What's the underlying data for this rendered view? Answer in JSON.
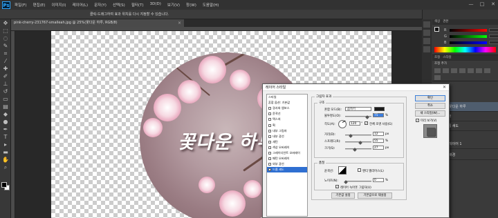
{
  "app": {
    "logo": "Ps",
    "menu": [
      "파일(F)",
      "편집(E)",
      "이미지(I)",
      "레이어(L)",
      "문자(Y)",
      "선택(S)",
      "필터(T)",
      "3D(D)",
      "보기(V)",
      "창(W)",
      "도움말(H)"
    ],
    "window_controls": [
      "—",
      "□",
      "✕"
    ]
  },
  "document": {
    "tab_title": "pink-cherry-231767-smalleah.jpg @ 25%(꽃다운 하루, RGB/8)",
    "tab_close": "×",
    "status_hint": "클릭-드래그하여 효과 위치를 다시 지정할 수 있습니다."
  },
  "canvas": {
    "text": "꽃다운 하루"
  },
  "color_panel": {
    "tabs": [
      "색상",
      "견본"
    ],
    "sliders": [
      {
        "label": "R",
        "color": "#d23c3c"
      },
      {
        "label": "G",
        "color": "#3cb43c"
      },
      {
        "label": "B",
        "color": "#3c5ad2"
      }
    ]
  },
  "adjust_panel": {
    "tabs": [
      "조정",
      "스타일"
    ],
    "title": "조정 추가"
  },
  "layers": [
    {
      "name": "꽃다운 하루",
      "type": "text",
      "selected": true
    },
    {
      "name": "효과",
      "type": "fx",
      "selected": false
    },
    {
      "name": "드롭 섀도",
      "type": "fx-item",
      "selected": false
    },
    {
      "name": "레이어 1",
      "type": "photo",
      "selected": false
    },
    {
      "name": "배경",
      "type": "bg",
      "selected": false
    }
  ],
  "dialog": {
    "title": "레이어 스타일",
    "close": "✕",
    "style_list": [
      {
        "label": "스타일",
        "checkbox": false,
        "selected": false
      },
      {
        "label": "혼합 옵션: 기본값",
        "checkbox": false,
        "selected": false
      },
      {
        "label": "경사와 엠보스",
        "checkbox": true,
        "selected": false
      },
      {
        "label": "윤곽선",
        "checkbox": true,
        "selected": false
      },
      {
        "label": "텍스처",
        "checkbox": true,
        "selected": false
      },
      {
        "label": "획",
        "checkbox": true,
        "selected": false
      },
      {
        "label": "내부 그림자",
        "checkbox": true,
        "selected": false
      },
      {
        "label": "내부 광선",
        "checkbox": true,
        "selected": false
      },
      {
        "label": "새틴",
        "checkbox": true,
        "selected": false
      },
      {
        "label": "색상 오버레이",
        "checkbox": true,
        "selected": false
      },
      {
        "label": "그레이디언트 오버레이",
        "checkbox": true,
        "selected": false
      },
      {
        "label": "패턴 오버레이",
        "checkbox": true,
        "selected": false
      },
      {
        "label": "외부 광선",
        "checkbox": true,
        "selected": false
      },
      {
        "label": "드롭 섀도",
        "checkbox": true,
        "selected": true
      }
    ],
    "section_title": "그림자 효과",
    "structure": {
      "title": "구조",
      "blend_mode_label": "혼합 모드(B):",
      "blend_mode_value": "곱하기",
      "opacity_label": "불투명도(O):",
      "opacity_value": "75",
      "angle_label": "각도(A):",
      "angle_value": "120",
      "global_light_label": "전체 조명 사용(G)",
      "distance_label": "거리(D):",
      "distance_value": "12",
      "spread_label": "스프레드(R):",
      "spread_value": "55",
      "size_label": "크기(S):",
      "size_value": "27",
      "unit_percent": "%",
      "unit_px": "px",
      "unit_degree": "°"
    },
    "quality": {
      "title": "품질",
      "contour_label": "윤곽선:",
      "antialias_label": "앤티 앨리어스(L)",
      "noise_label": "노이즈(N):",
      "noise_value": "0",
      "knockout_label": "레이어 녹아웃 그림자(U)"
    },
    "buttons": {
      "make_default": "기본값 설정",
      "reset_default": "기본값으로 재설정",
      "ok": "확인",
      "cancel": "취소",
      "new_style": "새 스타일(W)...",
      "preview": "미리 보기(V)"
    }
  }
}
